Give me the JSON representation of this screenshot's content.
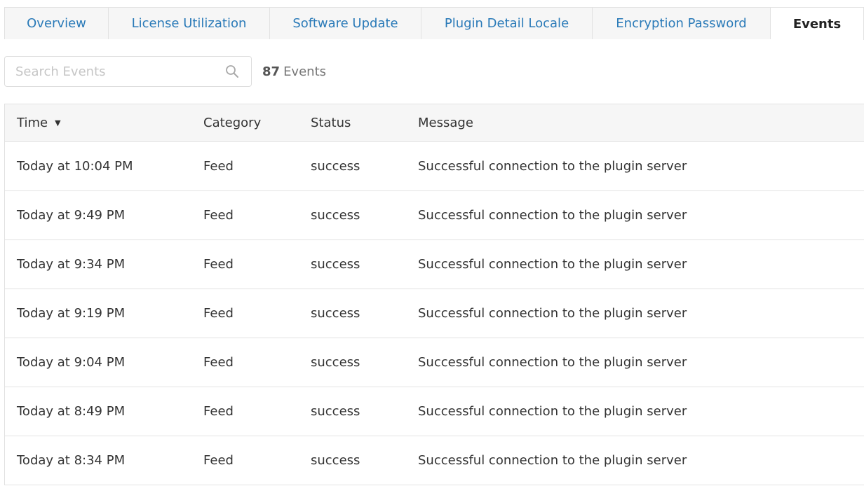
{
  "tabs": [
    {
      "label": "Overview",
      "active": false
    },
    {
      "label": "License Utilization",
      "active": false
    },
    {
      "label": "Software Update",
      "active": false
    },
    {
      "label": "Plugin Detail Locale",
      "active": false
    },
    {
      "label": "Encryption Password",
      "active": false
    },
    {
      "label": "Events",
      "active": true
    }
  ],
  "search": {
    "placeholder": "Search Events",
    "value": "",
    "icon": "search-icon"
  },
  "events_count": {
    "number": "87",
    "label": "Events"
  },
  "table": {
    "columns": {
      "time": "Time",
      "category": "Category",
      "status": "Status",
      "message": "Message"
    },
    "sort": {
      "column": "time",
      "direction": "descending",
      "indicator": "▼"
    },
    "rows": [
      {
        "time": "Today at 10:04 PM",
        "category": "Feed",
        "status": "success",
        "message": "Successful connection to the plugin server"
      },
      {
        "time": "Today at 9:49 PM",
        "category": "Feed",
        "status": "success",
        "message": "Successful connection to the plugin server"
      },
      {
        "time": "Today at 9:34 PM",
        "category": "Feed",
        "status": "success",
        "message": "Successful connection to the plugin server"
      },
      {
        "time": "Today at 9:19 PM",
        "category": "Feed",
        "status": "success",
        "message": "Successful connection to the plugin server"
      },
      {
        "time": "Today at 9:04 PM",
        "category": "Feed",
        "status": "success",
        "message": "Successful connection to the plugin server"
      },
      {
        "time": "Today at 8:49 PM",
        "category": "Feed",
        "status": "success",
        "message": "Successful connection to the plugin server"
      },
      {
        "time": "Today at 8:34 PM",
        "category": "Feed",
        "status": "success",
        "message": "Successful connection to the plugin server"
      }
    ]
  },
  "colors": {
    "link": "#2a7ab8",
    "active_tab_text": "#222222",
    "border": "#e2e2e2",
    "header_bg": "#f6f6f6"
  }
}
